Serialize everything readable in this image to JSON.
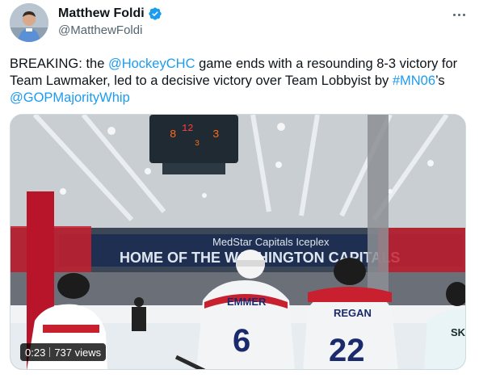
{
  "author": {
    "display_name": "Matthew Foldi",
    "handle": "@MatthewFoldi",
    "verified": true,
    "verified_color": "#1d9bf0"
  },
  "tweet": {
    "segments": [
      {
        "type": "text",
        "value": "BREAKING: the "
      },
      {
        "type": "mention",
        "value": "@HockeyCHC"
      },
      {
        "type": "text",
        "value": " game ends with a resounding 8-3 victory for Team Lawmaker, led to a decisive victory over Team Lobbyist by "
      },
      {
        "type": "hashtag",
        "value": "#MN06"
      },
      {
        "type": "text",
        "value": "’s "
      },
      {
        "type": "mention",
        "value": "@GOPMajorityWhip"
      }
    ],
    "link_color": "#1d9bf0"
  },
  "media": {
    "type": "video",
    "duration": "0:23",
    "views": "737 views",
    "scoreboard": {
      "home": "8",
      "away": "3",
      "center": "12",
      "period": "3"
    },
    "banner_text": "MedStar Capitals Iceplex",
    "wall_text": "HOME OF THE WASHINGTON CAPITALS",
    "players": [
      {
        "name": "EMMER",
        "number": "6"
      },
      {
        "name": "REGAN",
        "number": "22"
      },
      {
        "name": "SK",
        "number": ""
      }
    ]
  },
  "icons": {
    "verified": "verified-badge-icon",
    "more": "more-options-icon"
  }
}
